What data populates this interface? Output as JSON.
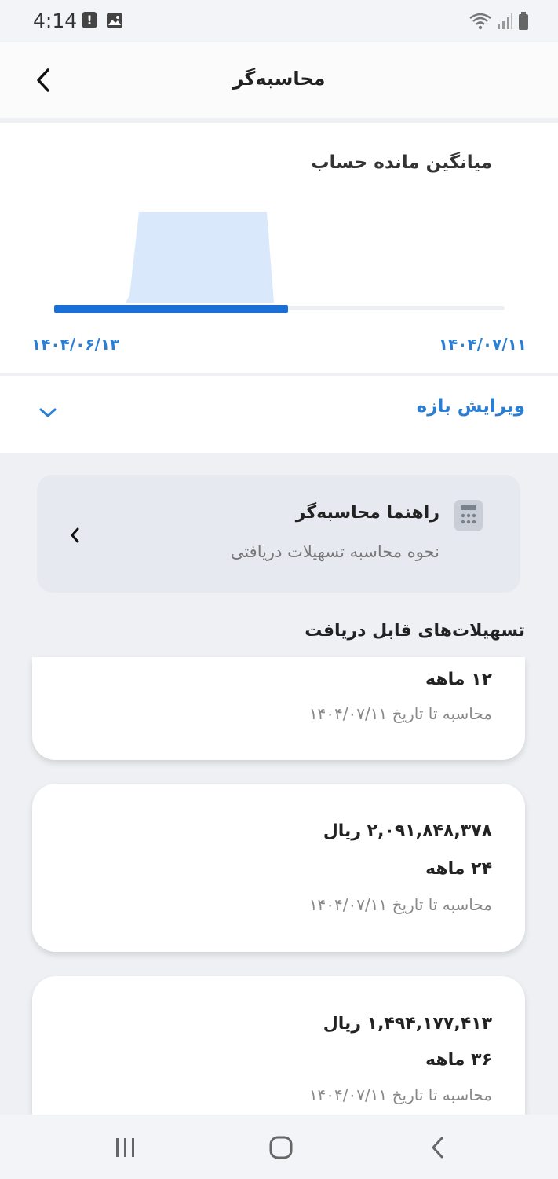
{
  "status_bar": {
    "time": "4:14"
  },
  "header": {
    "title": "محاسبه‌گر"
  },
  "chart": {
    "title": "میانگین مانده حساب",
    "x_start_label": "۱۴۰۴/۰۶/۱۳",
    "x_end_label": "۱۴۰۴/۰۷/۱۱",
    "colors": {
      "fill": "#d9e9fb",
      "progress": "#1a6fd6",
      "track": "#eceef1"
    },
    "progress": 0.52
  },
  "range": {
    "label": "ویرایش بازه"
  },
  "guide": {
    "title": "راهنما محاسبه‌گر",
    "subtitle": "نحوه محاسبه تسهیلات دریافتی"
  },
  "offers_section": {
    "title": "تسهیلات‌های قابل دریافت"
  },
  "offers": [
    {
      "term": "۱۲ ماهه",
      "date_text": "محاسبه تا تاریخ ۱۴۰۴/۰۷/۱۱"
    },
    {
      "amount": "۲,۰۹۱,۸۴۸,۳۷۸ ریال",
      "term": "۲۴ ماهه",
      "date_text": "محاسبه تا تاریخ ۱۴۰۴/۰۷/۱۱"
    },
    {
      "amount": "۱,۴۹۴,۱۷۷,۴۱۳ ریال",
      "term": "۳۶ ماهه",
      "date_text": "محاسبه تا تاریخ ۱۴۰۴/۰۷/۱۱"
    }
  ]
}
